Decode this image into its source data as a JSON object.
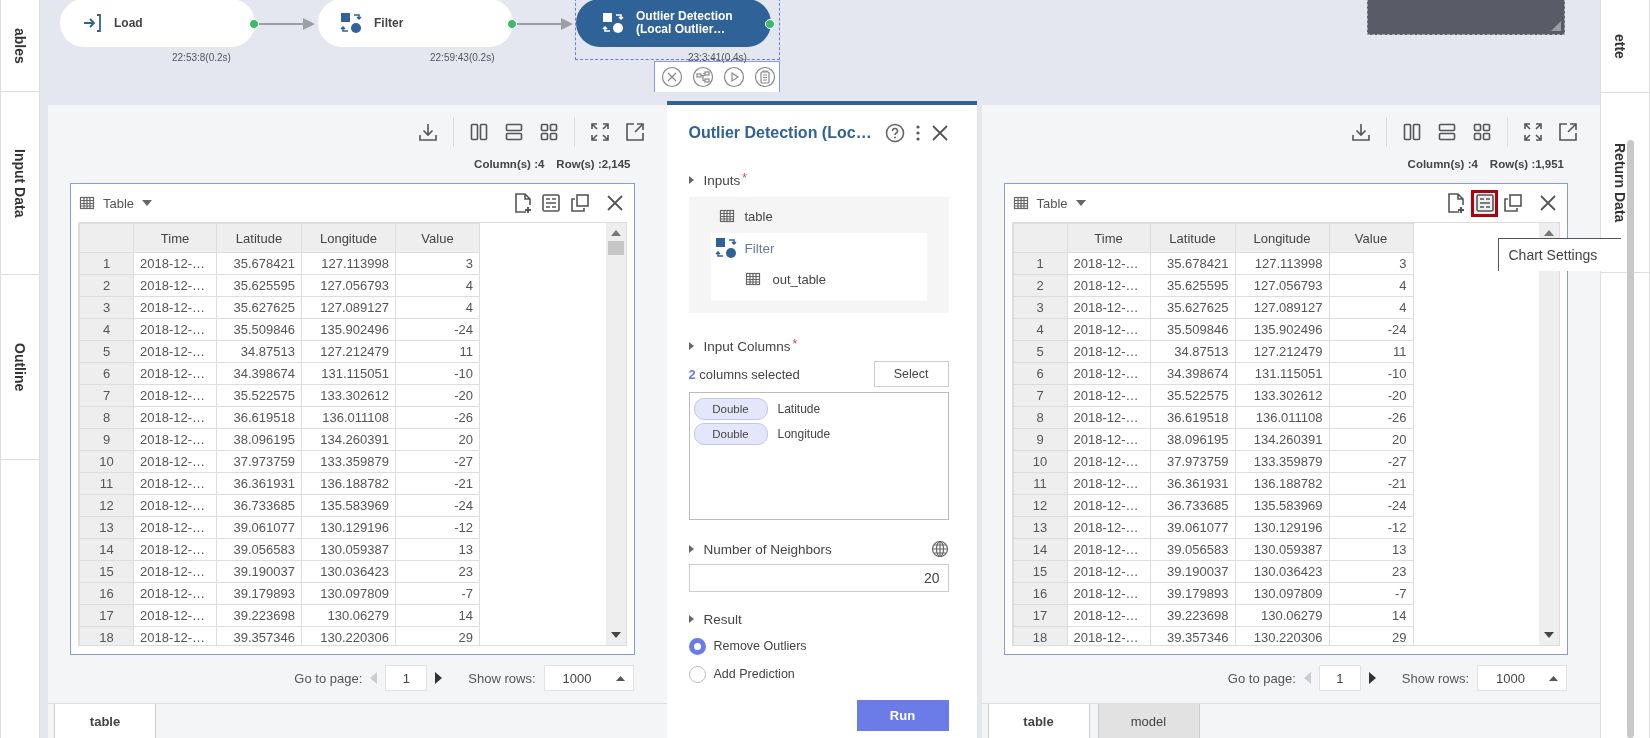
{
  "side_left": [
    {
      "label": "ables"
    },
    {
      "label": "Input Data"
    },
    {
      "label": "Outline"
    }
  ],
  "workflow": {
    "nodes": [
      {
        "label": "Load",
        "kind": "load",
        "time": "22:53:8(0.2s)",
        "selected": false
      },
      {
        "label": "Filter",
        "kind": "transform",
        "time": "22:59:43(0.2s)",
        "selected": false
      },
      {
        "label": "Outlier Detection (Local Outlier…",
        "kind": "transform",
        "time": "23:3:41(0.4s)",
        "selected": true
      }
    ]
  },
  "input_panel": {
    "columns_count": "Column(s) :4",
    "rows_count": "Row(s) :2,145",
    "view": "Table",
    "chart_settings_highlighted": false,
    "table": {
      "columns": [
        "",
        "Time",
        "Latitude",
        "Longitude",
        "Value"
      ],
      "rows": [
        [
          "1",
          "2018-12-…",
          "35.678421",
          "127.113998",
          "3"
        ],
        [
          "2",
          "2018-12-…",
          "35.625595",
          "127.056793",
          "4"
        ],
        [
          "3",
          "2018-12-…",
          "35.627625",
          "127.089127",
          "4"
        ],
        [
          "4",
          "2018-12-…",
          "35.509846",
          "135.902496",
          "-24"
        ],
        [
          "5",
          "2018-12-…",
          "34.87513",
          "127.212479",
          "11"
        ],
        [
          "6",
          "2018-12-…",
          "34.398674",
          "131.115051",
          "-10"
        ],
        [
          "7",
          "2018-12-…",
          "35.522575",
          "133.302612",
          "-20"
        ],
        [
          "8",
          "2018-12-…",
          "36.619518",
          "136.011108",
          "-26"
        ],
        [
          "9",
          "2018-12-…",
          "38.096195",
          "134.260391",
          "20"
        ],
        [
          "10",
          "2018-12-…",
          "37.973759",
          "133.359879",
          "-27"
        ],
        [
          "11",
          "2018-12-…",
          "36.361931",
          "136.188782",
          "-21"
        ],
        [
          "12",
          "2018-12-…",
          "36.733685",
          "135.583969",
          "-24"
        ],
        [
          "13",
          "2018-12-…",
          "39.061077",
          "130.129196",
          "-12"
        ],
        [
          "14",
          "2018-12-…",
          "39.056583",
          "130.059387",
          "13"
        ],
        [
          "15",
          "2018-12-…",
          "39.190037",
          "130.036423",
          "23"
        ],
        [
          "16",
          "2018-12-…",
          "39.179893",
          "130.097809",
          "-7"
        ],
        [
          "17",
          "2018-12-…",
          "39.223698",
          "130.06279",
          "14"
        ],
        [
          "18",
          "2018-12-…",
          "39.357346",
          "130.220306",
          "29"
        ]
      ]
    },
    "pager": {
      "page_label": "Go to page:",
      "page": "1",
      "rows_label": "Show rows:",
      "rows": "1000"
    },
    "tabs": [
      {
        "label": "table",
        "selected": true
      }
    ]
  },
  "properties": {
    "title": "Outlier Detection (Loc…",
    "inputs": {
      "label": "Inputs",
      "required_mark": "*",
      "table": "table",
      "source": "Filter",
      "output": "out_table"
    },
    "input_columns": {
      "label": "Input Columns",
      "required_mark": "*",
      "summary": "**2** columns selected",
      "button": "Select",
      "columns": [
        {
          "type": "Double",
          "name": "Latitude"
        },
        {
          "type": "Double",
          "name": "Longitude"
        }
      ]
    },
    "neighbors": {
      "label": "Number of Neighbors",
      "value": "20"
    },
    "result": {
      "label": "Result",
      "options": [
        {
          "label": "Remove Outliers",
          "selected": true
        },
        {
          "label": "Add Prediction",
          "selected": false
        }
      ]
    },
    "run_button": "Run"
  },
  "output_panel": {
    "columns_count": "Column(s) :4",
    "rows_count": "Row(s) :1,951",
    "view": "Table",
    "chart_settings_highlighted": true,
    "tooltip": "Chart Settings",
    "table": {
      "columns": [
        "",
        "Time",
        "Latitude",
        "Longitude",
        "Value"
      ],
      "rows": [
        [
          "1",
          "2018-12-…",
          "35.678421",
          "127.113998",
          "3"
        ],
        [
          "2",
          "2018-12-…",
          "35.625595",
          "127.056793",
          "4"
        ],
        [
          "3",
          "2018-12-…",
          "35.627625",
          "127.089127",
          "4"
        ],
        [
          "4",
          "2018-12-…",
          "35.509846",
          "135.902496",
          "-24"
        ],
        [
          "5",
          "2018-12-…",
          "34.87513",
          "127.212479",
          "11"
        ],
        [
          "6",
          "2018-12-…",
          "34.398674",
          "131.115051",
          "-10"
        ],
        [
          "7",
          "2018-12-…",
          "35.522575",
          "133.302612",
          "-20"
        ],
        [
          "8",
          "2018-12-…",
          "36.619518",
          "136.011108",
          "-26"
        ],
        [
          "9",
          "2018-12-…",
          "38.096195",
          "134.260391",
          "20"
        ],
        [
          "10",
          "2018-12-…",
          "37.973759",
          "133.359879",
          "-27"
        ],
        [
          "11",
          "2018-12-…",
          "36.361931",
          "136.188782",
          "-21"
        ],
        [
          "12",
          "2018-12-…",
          "36.733685",
          "135.583969",
          "-24"
        ],
        [
          "13",
          "2018-12-…",
          "39.061077",
          "130.129196",
          "-12"
        ],
        [
          "14",
          "2018-12-…",
          "39.056583",
          "130.059387",
          "13"
        ],
        [
          "15",
          "2018-12-…",
          "39.190037",
          "130.036423",
          "23"
        ],
        [
          "16",
          "2018-12-…",
          "39.179893",
          "130.097809",
          "-7"
        ],
        [
          "17",
          "2018-12-…",
          "39.223698",
          "130.06279",
          "14"
        ],
        [
          "18",
          "2018-12-…",
          "39.357346",
          "130.220306",
          "29"
        ]
      ]
    },
    "pager": {
      "page_label": "Go to page:",
      "page": "1",
      "rows_label": "Show rows:",
      "rows": "1000"
    },
    "tabs": [
      {
        "label": "table",
        "selected": true
      },
      {
        "label": "model",
        "selected": false
      }
    ]
  },
  "side_right": [
    {
      "label": "ette"
    },
    {
      "label": "Return Data"
    }
  ]
}
